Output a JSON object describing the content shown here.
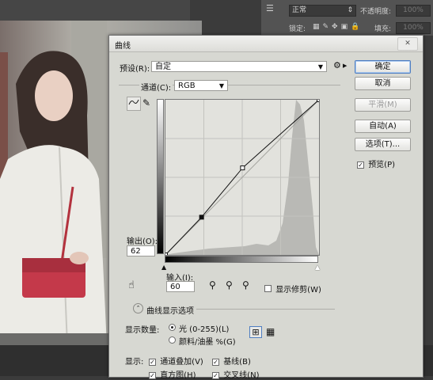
{
  "ps_panel": {
    "blend_mode": "正常",
    "opacity_label": "不透明度:",
    "opacity_value": "100%",
    "lock_label": "锁定:",
    "fill_label": "填充:",
    "fill_value": "100%"
  },
  "dialog": {
    "title": "曲线",
    "close_label": "✕",
    "preset_label": "预设(R):",
    "preset_value": "自定",
    "channel_label": "通道(C):",
    "channel_value": "RGB",
    "output_label": "输出(O):",
    "output_value": "62",
    "input_label": "输入(I):",
    "input_value": "60",
    "show_clipping_label": "显示修剪(W)",
    "display_options_label": "曲线显示选项",
    "show_amount_label": "显示数量:",
    "radio_light_label": "光 (0-255)(L)",
    "radio_pigment_label": "颜料/油墨 %(G)",
    "show_label": "显示:",
    "channel_overlays_label": "通道叠加(V)",
    "baseline_label": "基线(B)",
    "histogram_label": "直方图(H)",
    "intersection_label": "交叉线(N)"
  },
  "buttons": {
    "ok": "确定",
    "cancel": "取消",
    "smooth": "平滑(M)",
    "auto": "自动(A)",
    "options": "选项(T)...",
    "preview": "预览(P)"
  },
  "curve": {
    "points": [
      [
        0,
        0
      ],
      [
        60,
        62
      ],
      [
        128,
        143
      ],
      [
        255,
        255
      ]
    ]
  }
}
